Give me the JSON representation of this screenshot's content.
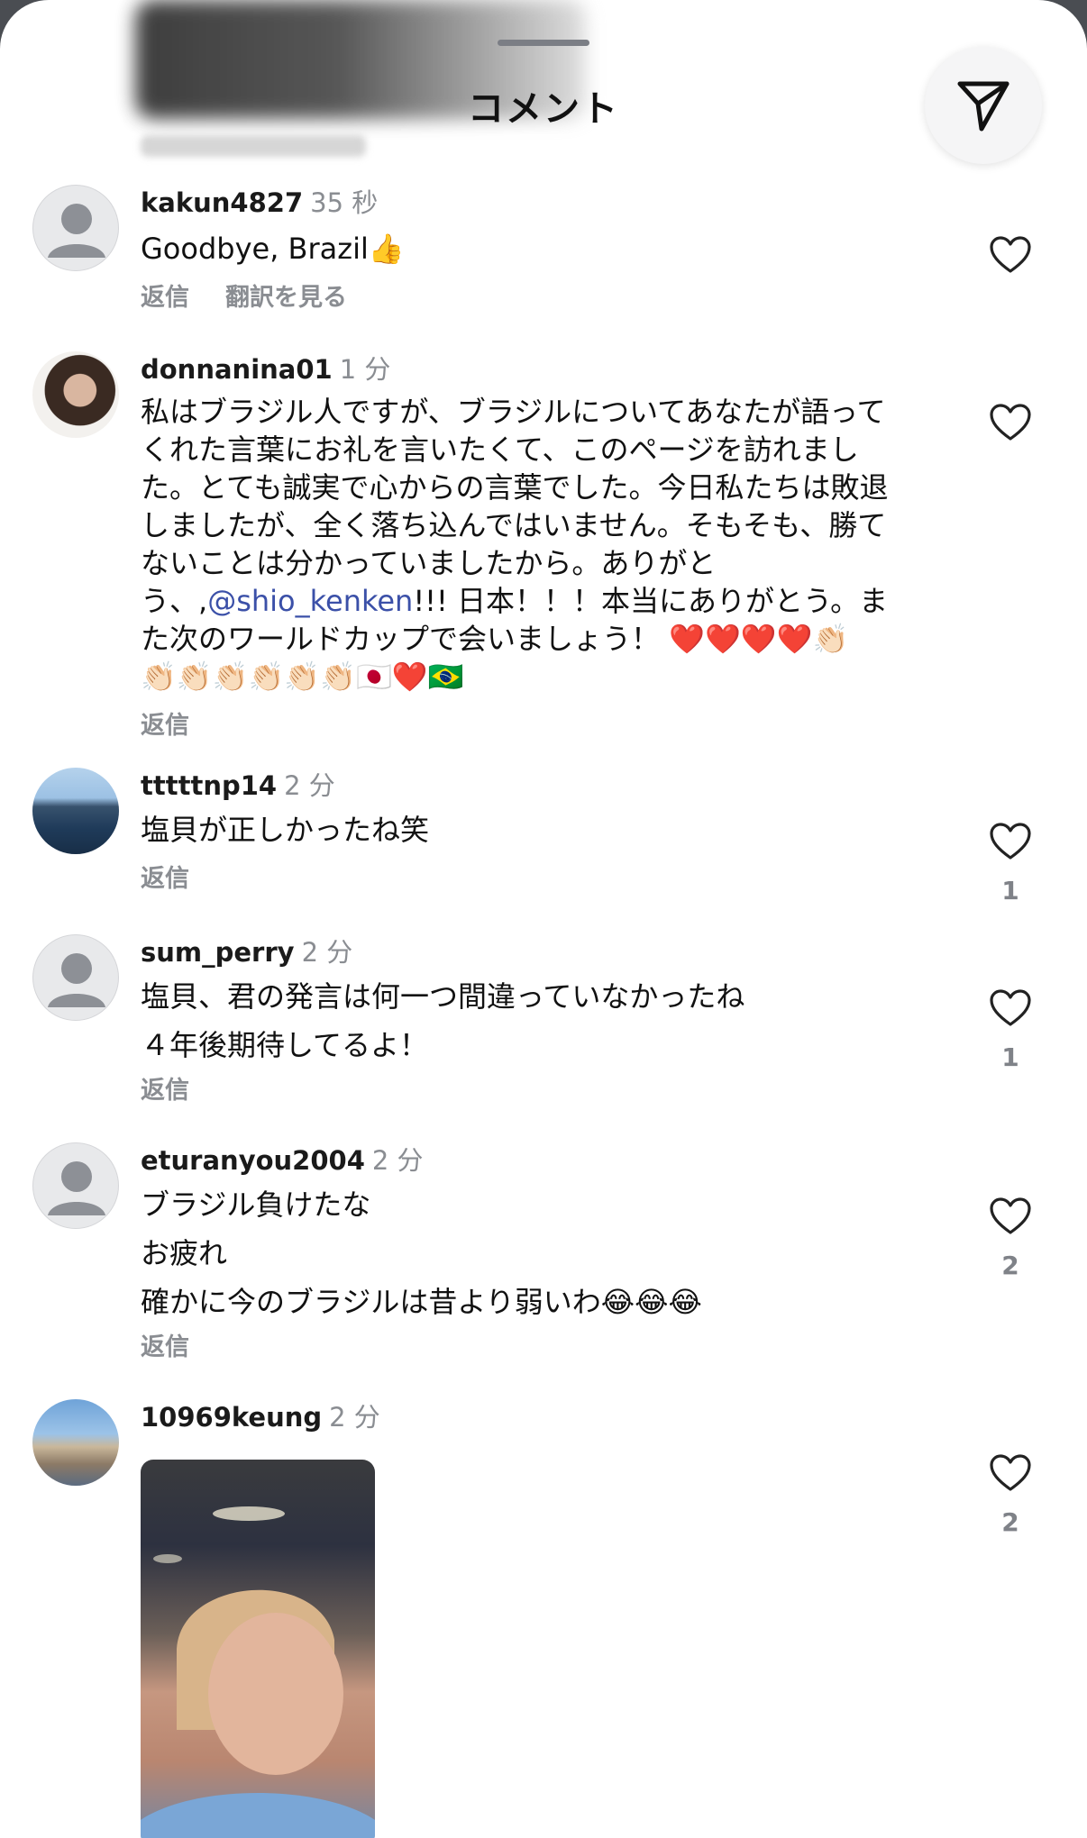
{
  "header": {
    "title": "コメント"
  },
  "comments": [
    {
      "username": "kakun4827",
      "time": "35 秒",
      "lines": [
        "Goodbye, Brazil👍"
      ],
      "reply_label": "返信",
      "translate_label": "翻訳を見る",
      "likes": ""
    },
    {
      "username": "donnanina01",
      "time": "1 分",
      "lines": [
        "私はブラジル人ですが、ブラジルについてあなたが語って",
        "くれた言葉にお礼を言いたくて、このページを訪れまし",
        "た。とても誠実で心からの言葉でした。今日私たちは敗退",
        "しましたが、全く落ち込んではいません。そもそも、勝て",
        "ないことは分かっていましたから。ありがと",
        "う、,",
        "@shio_kenken",
        "!!! 日本！！！本当にありがとう。ま",
        "た次のワールドカップで会いましょう！ ❤️❤️❤️❤️👏🏻",
        "👏🏻👏🏻👏🏻👏🏻👏🏻👏🏻🇯🇵❤️🇧🇷"
      ],
      "reply_label": "返信",
      "likes": ""
    },
    {
      "username": "tttttnp14",
      "time": "2 分",
      "lines": [
        "塩貝が正しかったね笑"
      ],
      "reply_label": "返信",
      "likes": "1"
    },
    {
      "username": "sum_perry",
      "time": "2 分",
      "lines": [
        "塩貝、君の発言は何一つ間違っていなかったね",
        "４年後期待してるよ！"
      ],
      "reply_label": "返信",
      "likes": "1"
    },
    {
      "username": "eturanyou2004",
      "time": "2 分",
      "lines": [
        "ブラジル負けたな",
        "お疲れ",
        "確かに今のブラジルは昔より弱いわ😂😂😂"
      ],
      "reply_label": "返信",
      "likes": "2"
    },
    {
      "username": "10969keung",
      "time": "2 分",
      "lines": [],
      "likes": "2"
    }
  ],
  "colors": {
    "mention": "#3b50a8",
    "meta_gray": "#8a8d92"
  },
  "icons": {
    "send": "send-icon",
    "like": "heart-outline-icon",
    "default_avatar": "default-avatar-icon"
  }
}
